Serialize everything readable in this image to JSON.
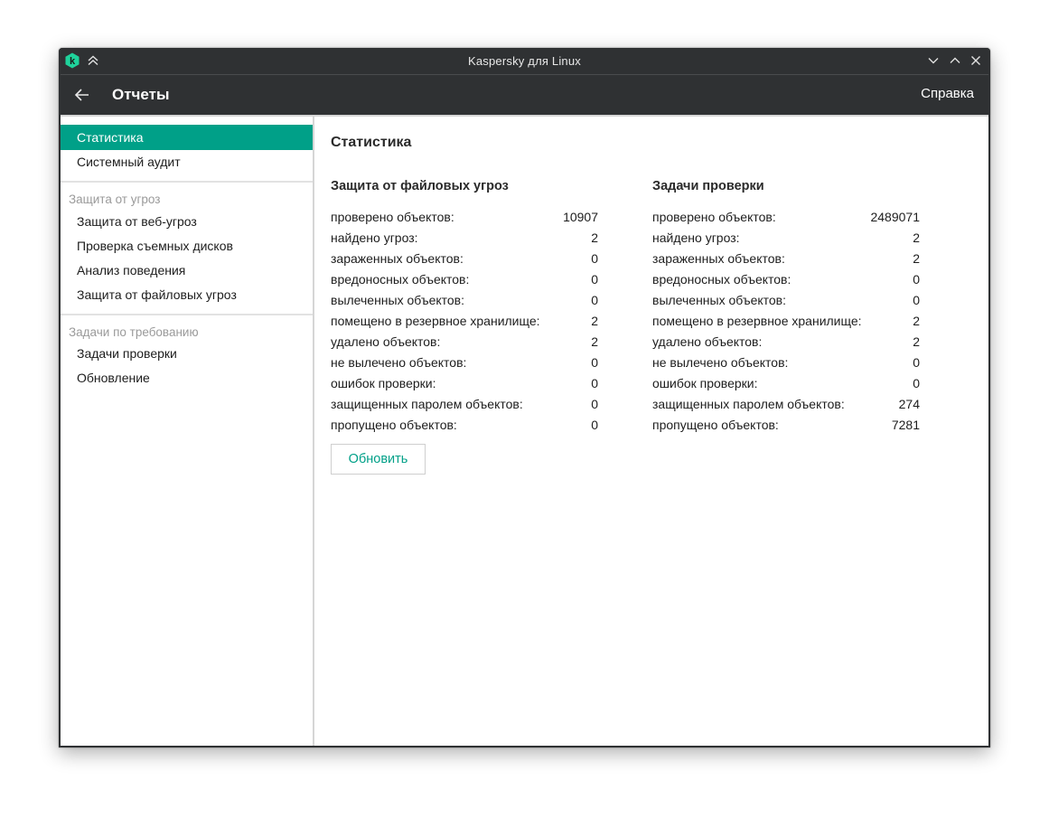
{
  "window": {
    "title": "Kaspersky для Linux"
  },
  "header": {
    "title": "Отчеты",
    "help_label": "Справка"
  },
  "sidebar": {
    "items_top": [
      {
        "label": "Статистика",
        "active": true
      },
      {
        "label": "Системный аудит",
        "active": false
      }
    ],
    "group_protection": {
      "label": "Защита от угроз",
      "items": [
        {
          "label": "Защита от веб-угроз"
        },
        {
          "label": "Проверка съемных дисков"
        },
        {
          "label": "Анализ поведения"
        },
        {
          "label": "Защита от файловых угроз"
        }
      ]
    },
    "group_tasks": {
      "label": "Задачи по требованию",
      "items": [
        {
          "label": "Задачи проверки"
        },
        {
          "label": "Обновление"
        }
      ]
    }
  },
  "main": {
    "heading": "Статистика",
    "file_protection": {
      "title": "Защита от файловых угроз",
      "rows": [
        {
          "label": "проверено объектов:",
          "value": "10907"
        },
        {
          "label": "найдено угроз:",
          "value": "2"
        },
        {
          "label": "зараженных объектов:",
          "value": "0"
        },
        {
          "label": "вредоносных объектов:",
          "value": "0"
        },
        {
          "label": "вылеченных объектов:",
          "value": "0"
        },
        {
          "label": "помещено в резервное хранилище:",
          "value": "2"
        },
        {
          "label": "удалено объектов:",
          "value": "2"
        },
        {
          "label": "не вылечено объектов:",
          "value": "0"
        },
        {
          "label": "ошибок проверки:",
          "value": "0"
        },
        {
          "label": "защищенных паролем объектов:",
          "value": "0"
        },
        {
          "label": "пропущено объектов:",
          "value": "0"
        }
      ]
    },
    "scan_tasks": {
      "title": "Задачи проверки",
      "rows": [
        {
          "label": "проверено объектов:",
          "value": "2489071"
        },
        {
          "label": "найдено угроз:",
          "value": "2"
        },
        {
          "label": "зараженных объектов:",
          "value": "2"
        },
        {
          "label": "вредоносных объектов:",
          "value": "0"
        },
        {
          "label": "вылеченных объектов:",
          "value": "0"
        },
        {
          "label": "помещено в резервное хранилище:",
          "value": "2"
        },
        {
          "label": "удалено объектов:",
          "value": "2"
        },
        {
          "label": "не вылечено объектов:",
          "value": "0"
        },
        {
          "label": "ошибок проверки:",
          "value": "0"
        },
        {
          "label": "защищенных паролем объектов:",
          "value": "274"
        },
        {
          "label": "пропущено объектов:",
          "value": "7281"
        }
      ]
    },
    "refresh_label": "Обновить"
  },
  "colors": {
    "accent": "#00a088",
    "titlebar": "#2f3133"
  }
}
